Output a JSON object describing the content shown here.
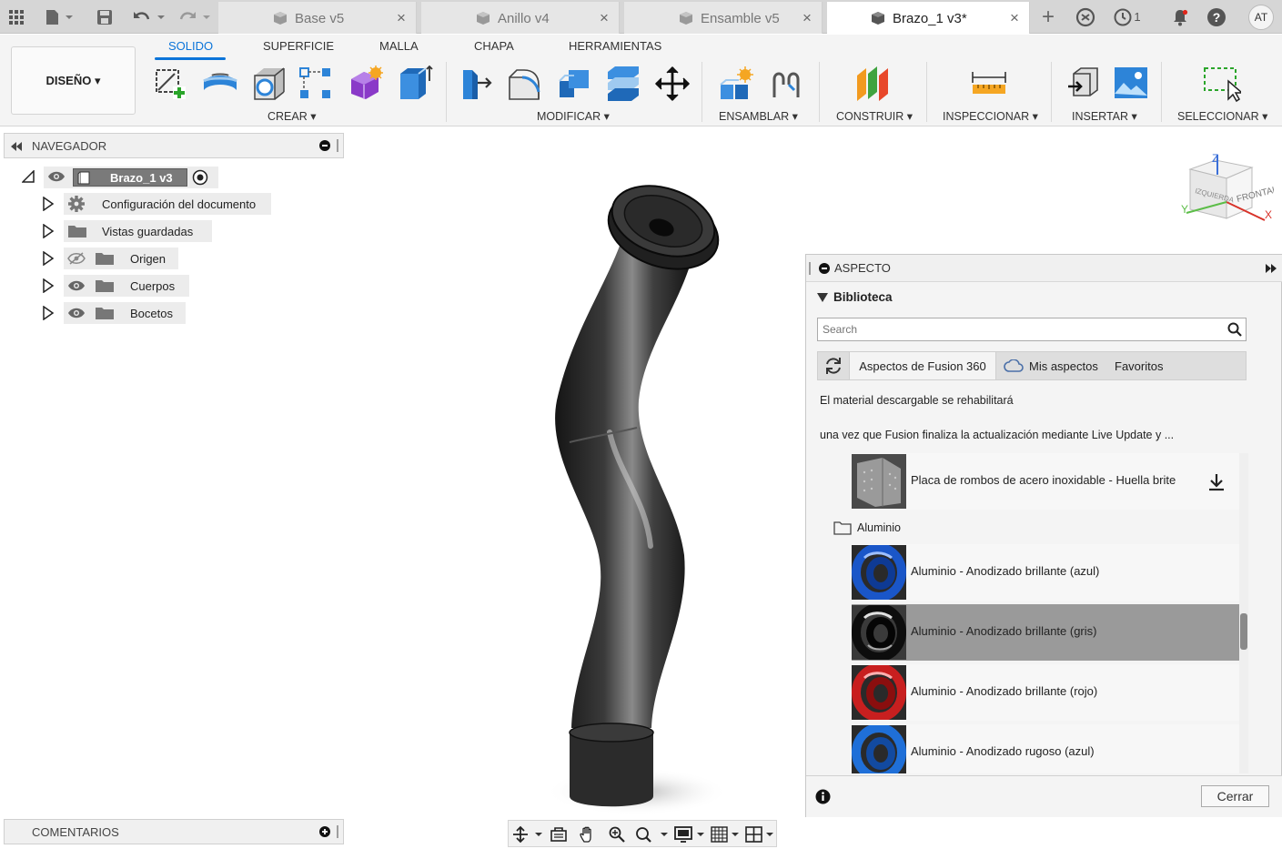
{
  "tabbar": {
    "tabs": [
      {
        "label": "Base v5",
        "active": false
      },
      {
        "label": "Anillo v4",
        "active": false
      },
      {
        "label": "Ensamble v5",
        "active": false
      },
      {
        "label": "Brazo_1 v3*",
        "active": true
      }
    ],
    "close_glyph": "×",
    "new_tab_glyph": "+",
    "jobs_count": "1",
    "avatar_initials": "AT"
  },
  "ribbon": {
    "workspace_label": "DISEÑO ▾",
    "tabs": [
      "SOLIDO",
      "SUPERFICIE",
      "MALLA",
      "CHAPA",
      "HERRAMIENTAS"
    ],
    "groups": [
      "CREAR ▾",
      "MODIFICAR ▾",
      "ENSAMBLAR ▾",
      "CONSTRUIR ▾",
      "INSPECCIONAR ▾",
      "INSERTAR ▾",
      "SELECCIONAR ▾"
    ]
  },
  "navigator": {
    "title": "NAVEGADOR",
    "root_label": "Brazo_1 v3",
    "items": [
      {
        "label": "Configuración del documento",
        "icon": "gear-icon"
      },
      {
        "label": "Vistas guardadas",
        "icon": "folder-icon"
      },
      {
        "label": "Origen",
        "icon": "folder-icon",
        "hidden": true
      },
      {
        "label": "Cuerpos",
        "icon": "folder-icon"
      },
      {
        "label": "Bocetos",
        "icon": "folder-icon"
      }
    ]
  },
  "viewcube": {
    "top_label": "FRONTAL",
    "side_label": "IZQUIERDA",
    "axis_z": "Z",
    "axis_x": "X",
    "axis_y": "Y"
  },
  "appearance": {
    "title": "ASPECTO",
    "section": "Biblioteca",
    "search_placeholder": "Search",
    "lib_tabs": [
      "Aspectos de Fusion 360",
      "Mis aspectos",
      "Favoritos"
    ],
    "notice_line1": "El material descargable se rehabilitará",
    "notice_line2": "una vez que Fusion finaliza la actualización mediante Live Update y ...",
    "folder": "Aluminio",
    "materials": [
      {
        "label": "Placa de rombos de acero inoxidable - Huella brite",
        "color": "#8a8a8a",
        "download": true,
        "selected": false
      },
      {
        "label": "Aluminio - Anodizado brillante (azul)",
        "color": "#1a56c8",
        "selected": false
      },
      {
        "label": "Aluminio - Anodizado brillante (gris)",
        "color": "#3a3a3a",
        "selected": true
      },
      {
        "label": "Aluminio - Anodizado brillante (rojo)",
        "color": "#c81f1f",
        "selected": false
      },
      {
        "label": "Aluminio - Anodizado rugoso (azul)",
        "color": "#1f6fd8",
        "selected": false
      }
    ],
    "close_label": "Cerrar"
  },
  "comments": {
    "title": "COMENTARIOS"
  },
  "colors": {
    "accent": "#0b74d9",
    "tab_bg": "#d6d6d6",
    "selected_row": "#9a9a9a"
  }
}
